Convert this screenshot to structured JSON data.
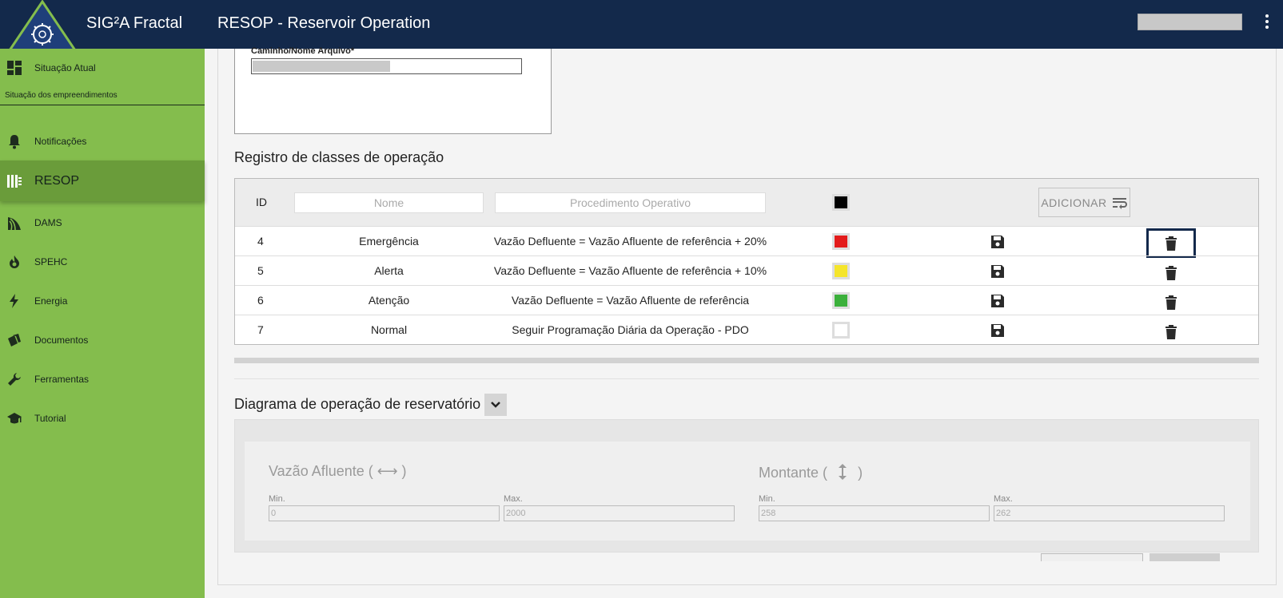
{
  "header": {
    "app_title": "SIG²A Fractal",
    "page_title": "RESOP - Reservoir Operation"
  },
  "sidebar": {
    "caption": "Situação dos empreendimentos",
    "items": [
      {
        "label": "Situação Atual",
        "icon": "dashboard-icon"
      },
      {
        "label": "Notificações",
        "icon": "bell-icon"
      },
      {
        "label": "RESOP",
        "icon": "dam-gates-icon",
        "active": true
      },
      {
        "label": "DAMS",
        "icon": "signal-icon"
      },
      {
        "label": "SPEHC",
        "icon": "flame-icon"
      },
      {
        "label": "Energia",
        "icon": "lightning-icon"
      },
      {
        "label": "Documentos",
        "icon": "documents-icon"
      },
      {
        "label": "Ferramentas",
        "icon": "wrench-icon"
      },
      {
        "label": "Tutorial",
        "icon": "graduation-cap-icon"
      }
    ]
  },
  "file_section": {
    "label": "Caminho/Nome Arquivo*"
  },
  "classes": {
    "title": "Registro de classes de operação",
    "header": {
      "id_label": "ID",
      "name_placeholder": "Nome",
      "procedure_placeholder": "Procedimento Operativo",
      "add_label": "ADICIONAR",
      "color": "#000000"
    },
    "rows": [
      {
        "id": "4",
        "name": "Emergência",
        "procedure": "Vazão Defluente = Vazão Afluente de referência + 20%",
        "color": "#e31b1b"
      },
      {
        "id": "5",
        "name": "Alerta",
        "procedure": "Vazão Defluente = Vazão Afluente de referência + 10%",
        "color": "#f5e52b"
      },
      {
        "id": "6",
        "name": "Atenção",
        "procedure": "Vazão Defluente = Vazão Afluente de referência",
        "color": "#3bb03b"
      },
      {
        "id": "7",
        "name": "Normal",
        "procedure": "Seguir Programação Diária da Operação - PDO",
        "color": "#ffffff"
      }
    ]
  },
  "diagram": {
    "title": "Diagrama de operação de reservatório",
    "inflow": {
      "title": "Vazão Afluente ( ⟷ )",
      "min_label": "Min.",
      "max_label": "Max.",
      "min": "0",
      "max": "2000"
    },
    "upstream": {
      "title": "Montante (",
      "title_end": ")",
      "min_label": "Min.",
      "max_label": "Max.",
      "min": "258",
      "max": "262"
    }
  }
}
